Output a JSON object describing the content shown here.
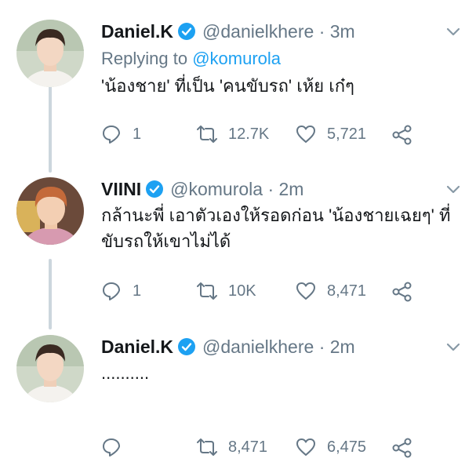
{
  "tweets": [
    {
      "name": "Daniel.K",
      "handle": "@danielkhere · 3m",
      "replying_prefix": "Replying to ",
      "replying_handle": "@komurola",
      "text": "'น้องชาย' ที่เป็น 'คนขับรถ' เห้ย เก๋ๆ",
      "replies": "1",
      "retweets": "12.7K",
      "likes": "5,721"
    },
    {
      "name": "VIINI",
      "handle": "@komurola · 2m",
      "text": "กล้านะพี่ เอาตัวเองให้รอดก่อน 'น้องชายเฉยๆ' ที่ขับรถให้เขาไม่ได้",
      "replies": "1",
      "retweets": "10K",
      "likes": "8,471"
    },
    {
      "name": "Daniel.K",
      "handle": "@danielkhere · 2m",
      "text": "..........",
      "replies": "",
      "retweets": "8,471",
      "likes": "6,475"
    }
  ],
  "colors": {
    "accent": "#1da1f2",
    "secondary_text": "#657786",
    "thread_line": "#ccd6dd"
  },
  "icons": [
    "verified-badge-icon",
    "chevron-down-icon",
    "reply-icon",
    "retweet-icon",
    "like-icon",
    "share-icon"
  ]
}
